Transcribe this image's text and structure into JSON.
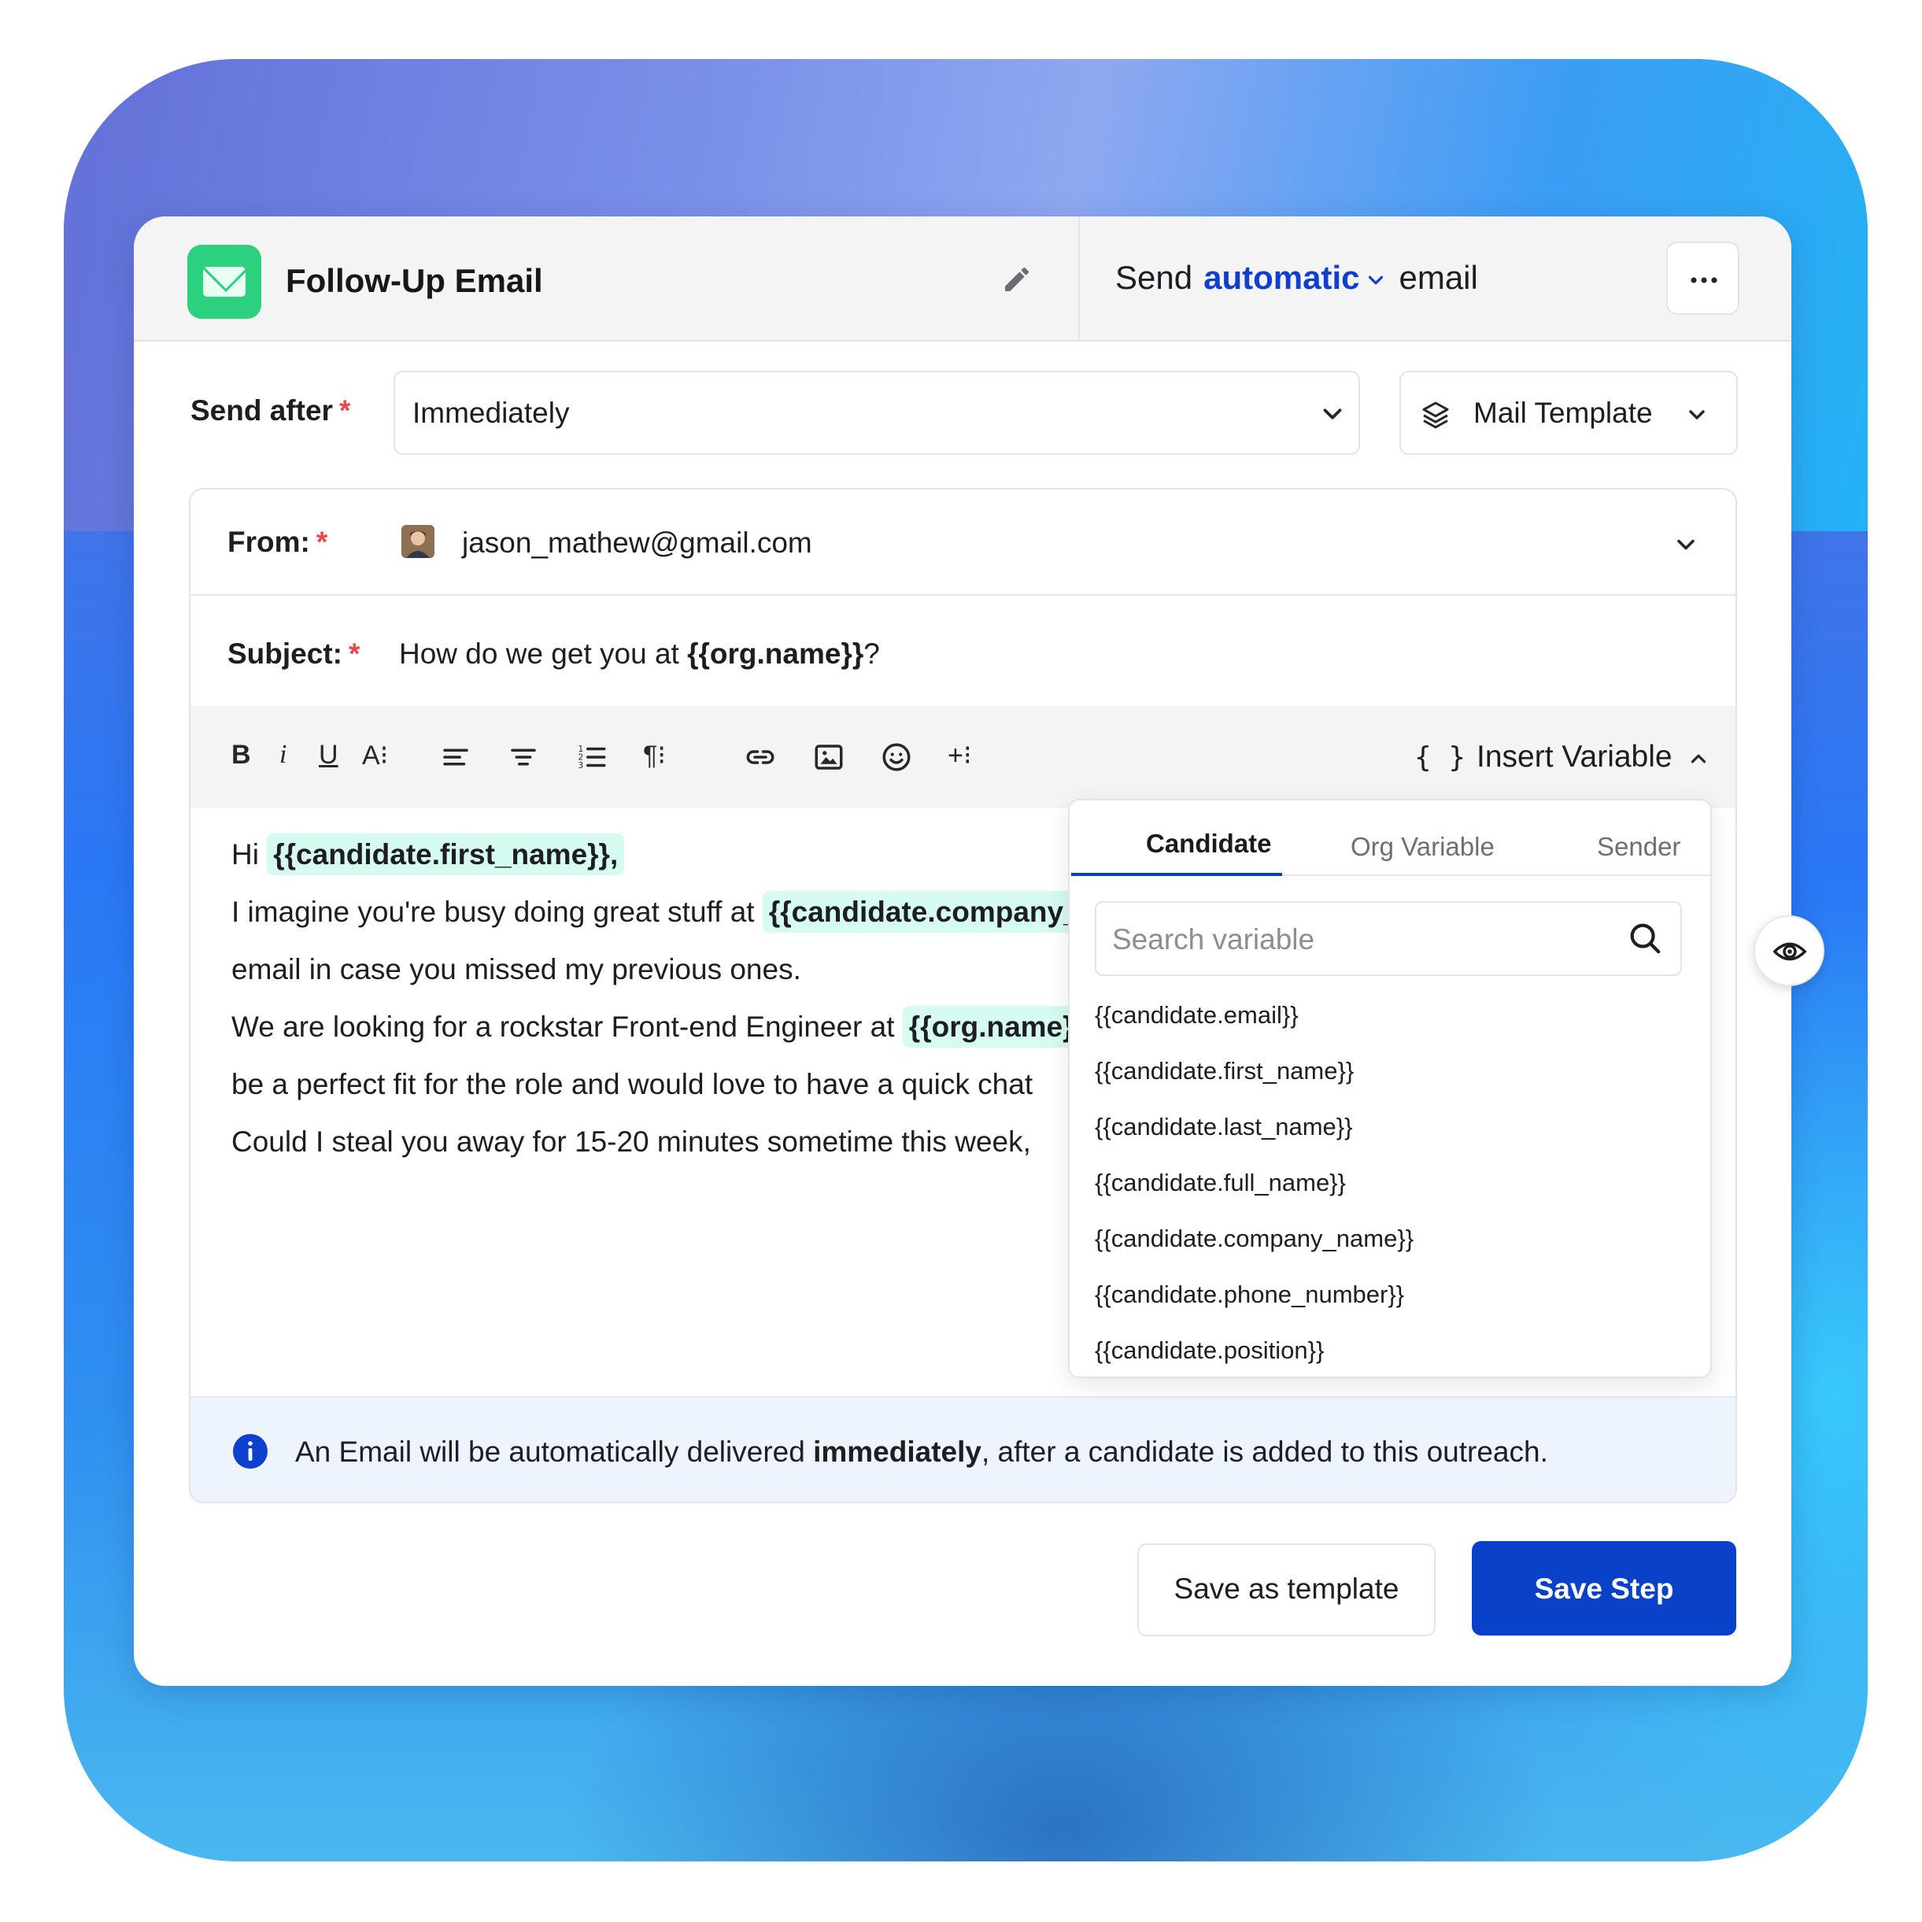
{
  "header": {
    "title": "Follow-Up Email",
    "send_prefix": "Send",
    "send_mode": "automatic",
    "send_suffix": "email"
  },
  "send_after": {
    "label": "Send after",
    "required_mark": "*",
    "value": "Immediately"
  },
  "mail_template": {
    "label": "Mail Template"
  },
  "from": {
    "label": "From:",
    "required_mark": "*",
    "email": "jason_mathew@gmail.com"
  },
  "subject": {
    "label": "Subject:",
    "required_mark": "*",
    "prefix": "How do we get you at ",
    "variable": "{{org.name}}",
    "suffix": "?"
  },
  "toolbar": {
    "insert_variable_braces": "{ }",
    "insert_variable_label": "Insert Variable",
    "icons": [
      "bold-icon",
      "italic-icon",
      "underline-icon",
      "font-size-icon",
      "align-left-icon",
      "align-center-icon",
      "numbered-list-icon",
      "paragraph-icon",
      "link-icon",
      "image-icon",
      "emoji-icon",
      "more-insert-icon"
    ]
  },
  "body": {
    "line1_prefix": "Hi ",
    "line1_var": "{{candidate.first_name}},",
    "line2_prefix": "I imagine you're busy doing great stuff at ",
    "line2_var": "{{candidate.company_name}}",
    "line3": "email in case you missed my previous ones.",
    "line4_prefix": "We are looking for a rockstar Front-end Engineer at ",
    "line4_var": "{{org.name}}",
    "line5": "be a perfect fit for the role and would love to have a quick chat",
    "line6": "Could I steal you away for 15-20 minutes sometime this week,"
  },
  "variable_dropdown": {
    "tabs": [
      "Candidate",
      "Org Variable",
      "Sender"
    ],
    "active_tab": "Candidate",
    "search_placeholder": "Search variable",
    "items": [
      "{{candidate.email}}",
      "{{candidate.first_name}}",
      "{{candidate.last_name}}",
      "{{candidate.full_name}}",
      "{{candidate.company_name}}",
      "{{candidate.phone_number}}",
      "{{candidate.position}}"
    ]
  },
  "info": {
    "prefix": "An Email will be automatically delivered ",
    "bold": "immediately",
    "suffix": ", after a candidate is added to this outreach."
  },
  "actions": {
    "save_template": "Save as template",
    "save_step": "Save Step"
  },
  "colors": {
    "primary": "#0942c8",
    "accent_text": "#0f3fce",
    "variable_chip": "#d6fbf1",
    "mail_icon": "#2bd17e",
    "required": "#e5484d",
    "info_bg": "#eef4fd"
  }
}
